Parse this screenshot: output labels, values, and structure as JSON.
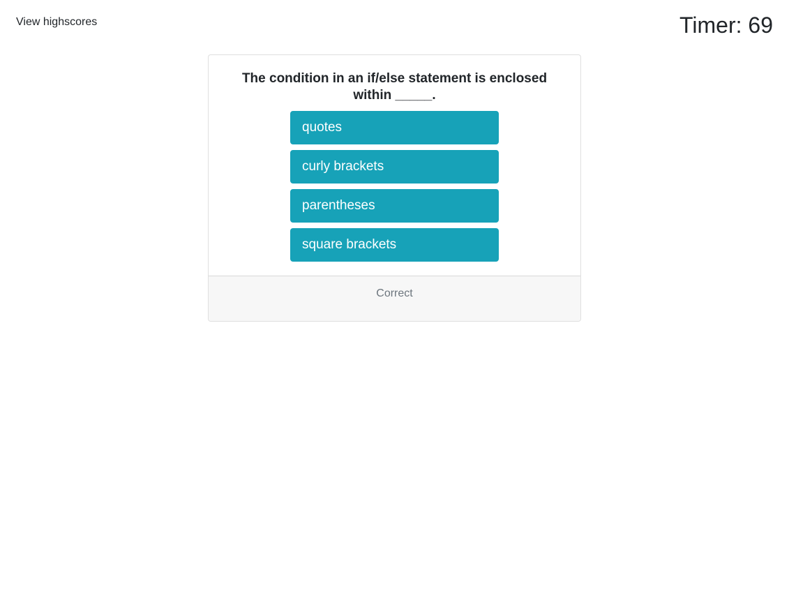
{
  "header": {
    "highscores_label": "View highscores",
    "timer_label": "Timer: ",
    "timer_value": "69"
  },
  "quiz": {
    "question": "The condition in an if/else statement is enclosed within _____.",
    "choices": [
      {
        "label": "quotes"
      },
      {
        "label": "curly brackets"
      },
      {
        "label": "parentheses"
      },
      {
        "label": "square brackets"
      }
    ],
    "feedback": "Correct"
  },
  "colors": {
    "choice_button": "#17a2b8",
    "footer_background": "#f7f7f7",
    "feedback_text": "#6c757d"
  }
}
